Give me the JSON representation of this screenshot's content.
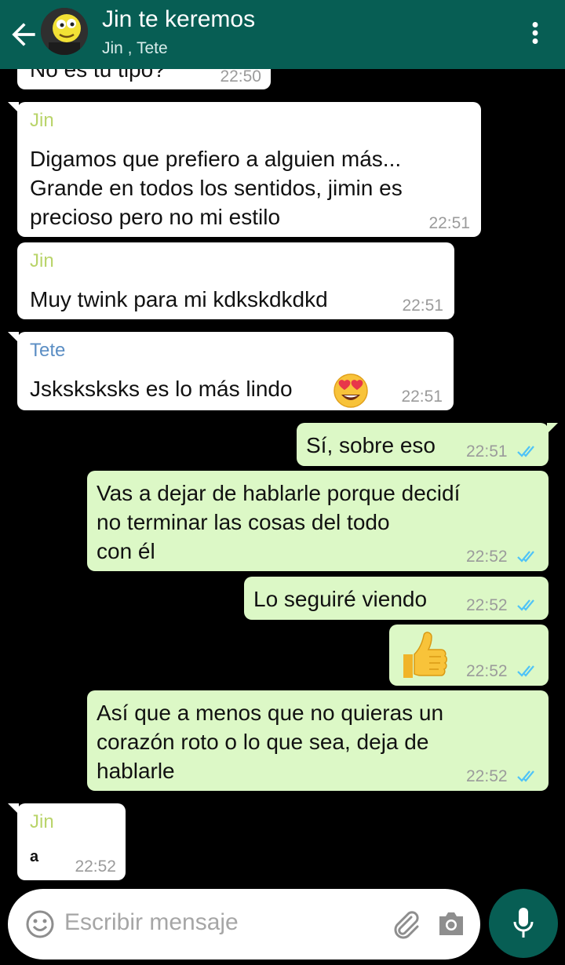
{
  "header": {
    "title": "Jin te keremos",
    "subtitle": "Jin , Tete"
  },
  "messages": [
    {
      "dir": "in",
      "text_lines": [
        "No es tu tipo?"
      ],
      "time": "22:50"
    },
    {
      "dir": "in",
      "sender": "Jin",
      "sender_color": "#b9d46a",
      "text_lines": [
        "Digamos que prefiero a alguien más...",
        "Grande en todos los sentidos, jimin es",
        "precioso pero no mi estilo"
      ],
      "time": "22:51"
    },
    {
      "dir": "in",
      "sender": "Jin",
      "sender_color": "#b9d46a",
      "text_lines": [
        "Muy twink para mi kdkskdkdkd"
      ],
      "time": "22:51"
    },
    {
      "dir": "in",
      "sender": "Tete",
      "sender_color": "#5b8ec4",
      "text_lines": [
        "Jsksksksks es lo más lindo"
      ],
      "emoji": "heart-eyes-emoji",
      "time": "22:51"
    },
    {
      "dir": "out",
      "text_lines": [
        "Sí, sobre eso"
      ],
      "time": "22:51",
      "status": "read"
    },
    {
      "dir": "out",
      "text_lines": [
        "Vas a dejar de hablarle porque decidí",
        "no terminar las cosas del todo",
        "con él"
      ],
      "time": "22:52",
      "status": "read"
    },
    {
      "dir": "out",
      "text_lines": [
        "Lo seguiré viendo"
      ],
      "time": "22:52",
      "status": "read"
    },
    {
      "dir": "out",
      "emoji": "thumbs-up-emoji",
      "time": "22:52",
      "status": "read"
    },
    {
      "dir": "out",
      "text_lines": [
        "Así que a menos que no quieras un",
        "corazón roto o lo que sea, deja de",
        "hablarle"
      ],
      "time": "22:52",
      "status": "read"
    },
    {
      "dir": "in",
      "sender": "Jin",
      "sender_color": "#b9d46a",
      "text_lines": [
        "a"
      ],
      "time": "22:52"
    }
  ],
  "composer": {
    "placeholder": "Escribir mensaje"
  },
  "colors": {
    "header_bg": "#075e54",
    "chat_bg": "#000000",
    "incoming_bg": "#ffffff",
    "outgoing_bg": "#dcf8c6",
    "read_ticks": "#4fc3f7"
  },
  "icons": [
    "back-arrow-icon",
    "group-avatar",
    "more-options-icon",
    "emoji-icon",
    "attach-icon",
    "camera-icon",
    "mic-icon",
    "double-check-icon"
  ]
}
